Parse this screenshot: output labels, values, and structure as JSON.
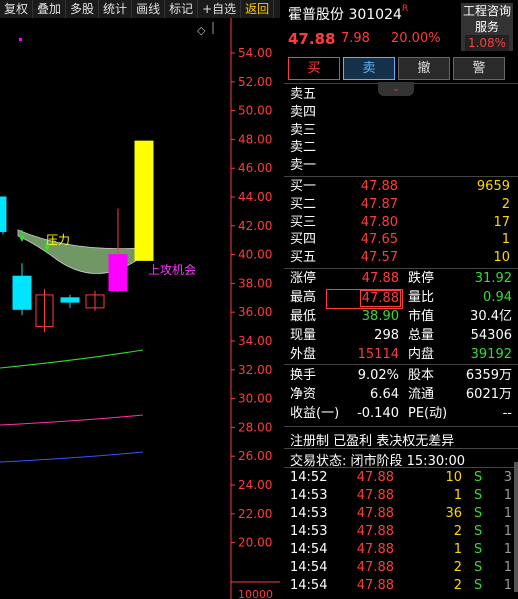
{
  "toolbar": {
    "items": [
      "复权",
      "叠加",
      "多股",
      "统计",
      "画线",
      "标记",
      "+自选",
      "返回"
    ]
  },
  "chart": {
    "price_labels": [
      "54.00",
      "52.00",
      "50.00",
      "48.00",
      "46.00",
      "44.00",
      "42.00",
      "40.00",
      "38.00",
      "36.00",
      "34.00",
      "32.00",
      "30.00",
      "28.00",
      "26.00",
      "24.00",
      "22.00",
      "20.00"
    ],
    "volume_label": "10000",
    "annotation_pressure": "压力",
    "annotation_opportunity": "上攻机会",
    "diamond": "◇",
    "colors": {
      "up": "#ff3b3b",
      "down": "#00e5ff",
      "limit": "#ffff00",
      "accent": "#ff00ff",
      "cloud": "#7ea86f",
      "line_green": "#33dd33",
      "line_magenta": "#ff33aa",
      "line_blue": "#3355ff"
    }
  },
  "stock": {
    "name": "霍普股份",
    "code": "301024",
    "r_mark": "R",
    "price": "47.88",
    "change": "7.98",
    "change_pct": "20.00%",
    "concept_line1": "工程咨询",
    "concept_line2": "服务",
    "concept_pct": "1.08%"
  },
  "buttons": {
    "buy": "买",
    "sell": "卖",
    "cancel": "撤",
    "alert": "警"
  },
  "expand_icon": "⌄",
  "sell_orders": [
    {
      "label": "卖五",
      "price": "",
      "volume": ""
    },
    {
      "label": "卖四",
      "price": "",
      "volume": ""
    },
    {
      "label": "卖三",
      "price": "",
      "volume": ""
    },
    {
      "label": "卖二",
      "price": "",
      "volume": ""
    },
    {
      "label": "卖一",
      "price": "",
      "volume": ""
    }
  ],
  "buy_orders": [
    {
      "label": "买一",
      "price": "47.88",
      "volume": "9659"
    },
    {
      "label": "买二",
      "price": "47.87",
      "volume": "2"
    },
    {
      "label": "买三",
      "price": "47.80",
      "volume": "17"
    },
    {
      "label": "买四",
      "price": "47.65",
      "volume": "1"
    },
    {
      "label": "买五",
      "price": "47.57",
      "volume": "10"
    }
  ],
  "quote": [
    {
      "l1": "涨停",
      "v1": "47.88",
      "c1": "red",
      "l2": "跌停",
      "v2": "31.92",
      "c2": "green"
    },
    {
      "l1": "最高",
      "v1": "47.88",
      "c1": "red boxed",
      "l2": "量比",
      "v2": "0.94",
      "c2": "green"
    },
    {
      "l1": "最低",
      "v1": "38.90",
      "c1": "green",
      "l2": "市值",
      "v2": "30.4亿",
      "c2": "white"
    },
    {
      "l1": "现量",
      "v1": "298",
      "c1": "white",
      "l2": "总量",
      "v2": "54306",
      "c2": "white"
    },
    {
      "l1": "外盘",
      "v1": "15114",
      "c1": "red",
      "l2": "内盘",
      "v2": "39192",
      "c2": "green"
    }
  ],
  "quote2": [
    {
      "l1": "换手",
      "v1": "9.02%",
      "c1": "white",
      "l2": "股本",
      "v2": "6359万",
      "c2": "white"
    },
    {
      "l1": "净资",
      "v1": "6.64",
      "c1": "white",
      "l2": "流通",
      "v2": "6021万",
      "c2": "white"
    },
    {
      "l1": "收益(一)",
      "v1": "-0.140",
      "c1": "white",
      "l2": "PE(动)",
      "v2": "--",
      "c2": "white"
    }
  ],
  "info": {
    "tags": "注册制 已盈利 表决权无差异",
    "status": "交易状态: 闭市阶段 15:30:00"
  },
  "ticks": [
    {
      "time": "14:52",
      "price": "47.88",
      "vol": "10",
      "side": "S",
      "num": "3"
    },
    {
      "time": "14:53",
      "price": "47.88",
      "vol": "1",
      "side": "S",
      "num": "1"
    },
    {
      "time": "14:53",
      "price": "47.88",
      "vol": "36",
      "side": "S",
      "num": "1"
    },
    {
      "time": "14:53",
      "price": "47.88",
      "vol": "2",
      "side": "S",
      "num": "1"
    },
    {
      "time": "14:54",
      "price": "47.88",
      "vol": "1",
      "side": "S",
      "num": "1"
    },
    {
      "time": "14:54",
      "price": "47.88",
      "vol": "2",
      "side": "S",
      "num": "1"
    },
    {
      "time": "14:54",
      "price": "47.88",
      "vol": "2",
      "side": "S",
      "num": "1"
    }
  ]
}
